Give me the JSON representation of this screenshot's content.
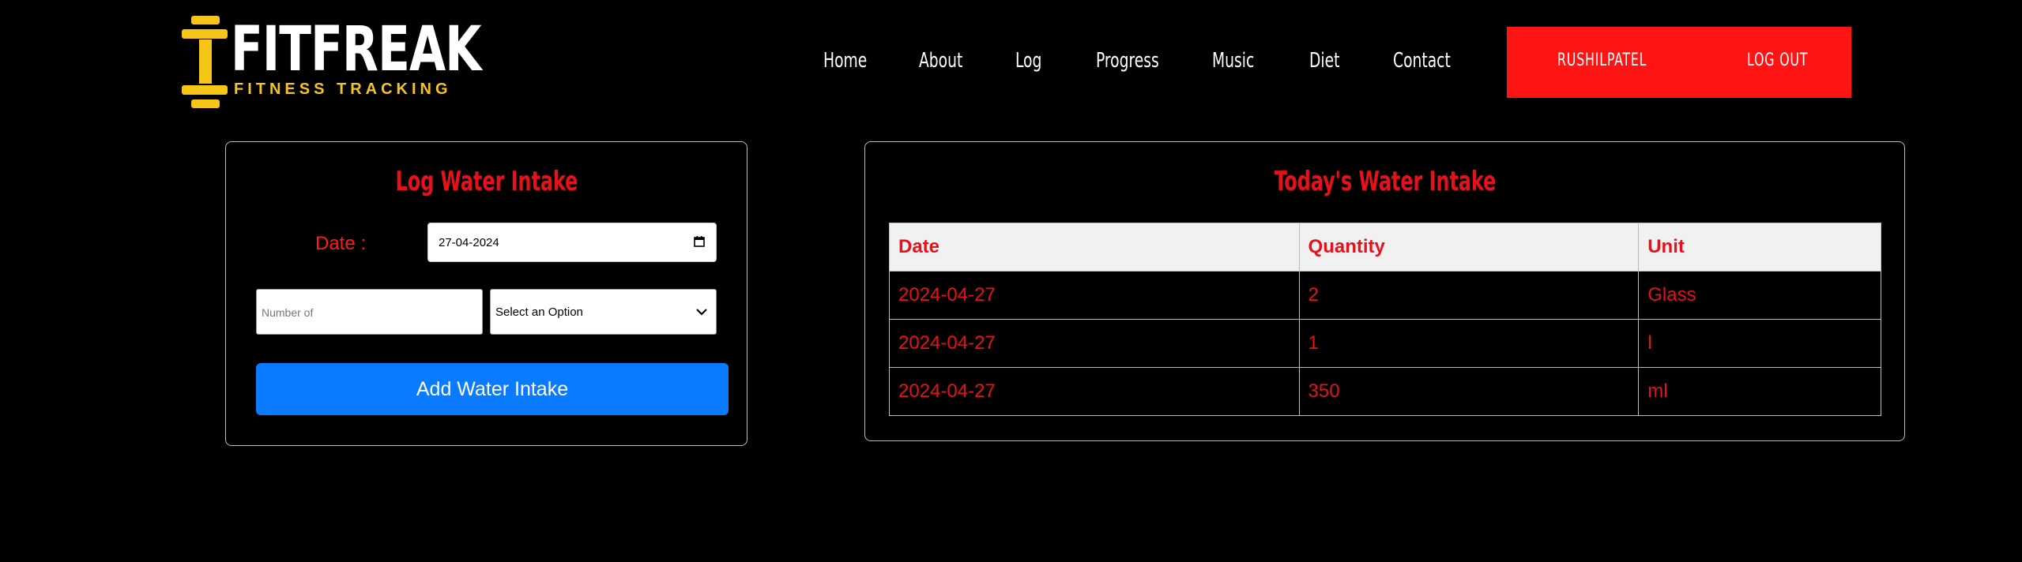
{
  "brand": {
    "name": "FITFREAK",
    "tagline": "FITNESS TRACKING",
    "colors": {
      "accent": "#f5c518",
      "red": "#ff1414",
      "blue": "#0a7bff"
    },
    "icon": "dumbbell-icon"
  },
  "nav": {
    "items": [
      "Home",
      "About",
      "Log",
      "Progress",
      "Music",
      "Diet",
      "Contact"
    ],
    "user": "RUSHILPATEL",
    "logout": "LOG OUT"
  },
  "log_form": {
    "title": "Log Water Intake",
    "date_label": "Date :",
    "date_value": "27-04-2024",
    "quantity_placeholder": "Number of",
    "unit_select_value": "Select an Option",
    "submit_label": "Add Water Intake"
  },
  "today": {
    "title": "Today's Water Intake",
    "columns": [
      "Date",
      "Quantity",
      "Unit"
    ],
    "rows": [
      [
        "2024-04-27",
        "2",
        "Glass"
      ],
      [
        "2024-04-27",
        "1",
        "l"
      ],
      [
        "2024-04-27",
        "350",
        "ml"
      ]
    ]
  }
}
